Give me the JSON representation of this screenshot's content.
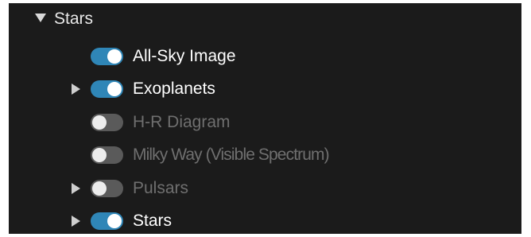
{
  "colors": {
    "panel_bg": "#1b1b1b",
    "toggle_on": "#2f86b7",
    "toggle_off": "#5a5a5a",
    "text_active": "#ffffff",
    "text_inactive": "#6f6f6f"
  },
  "group": {
    "label": "Stars",
    "expanded": true,
    "icon": "triangle-down-icon"
  },
  "layers": [
    {
      "label": "All-Sky Image",
      "enabled": true,
      "has_children": false
    },
    {
      "label": "Exoplanets",
      "enabled": true,
      "has_children": true
    },
    {
      "label": "H-R Diagram",
      "enabled": false,
      "has_children": false
    },
    {
      "label": "Milky Way (Visible Spectrum)",
      "enabled": false,
      "has_children": false
    },
    {
      "label": "Pulsars",
      "enabled": false,
      "has_children": true
    },
    {
      "label": "Stars",
      "enabled": true,
      "has_children": true
    }
  ]
}
